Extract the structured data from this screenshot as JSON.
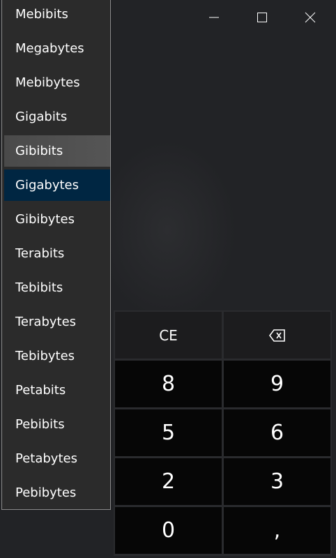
{
  "window_controls": {
    "minimize": "minimize-icon",
    "maximize": "maximize-icon",
    "close": "close-icon"
  },
  "dropdown": {
    "items": [
      "Mebibits",
      "Megabytes",
      "Mebibytes",
      "Gigabits",
      "Gibibits",
      "Gigabytes",
      "Gibibytes",
      "Terabits",
      "Tebibits",
      "Terabytes",
      "Tebibytes",
      "Petabits",
      "Pebibits",
      "Petabytes",
      "Pebibytes"
    ],
    "hovered": "Gibibits",
    "selected": "Gigabytes"
  },
  "keypad": {
    "ce": "CE",
    "backspace": "backspace-icon",
    "keys": [
      "8",
      "9",
      "5",
      "6",
      "2",
      "3",
      "0",
      ","
    ]
  },
  "colors": {
    "selected": "#002642",
    "hover": "#4d4d4d",
    "key_bg": "#060606"
  }
}
